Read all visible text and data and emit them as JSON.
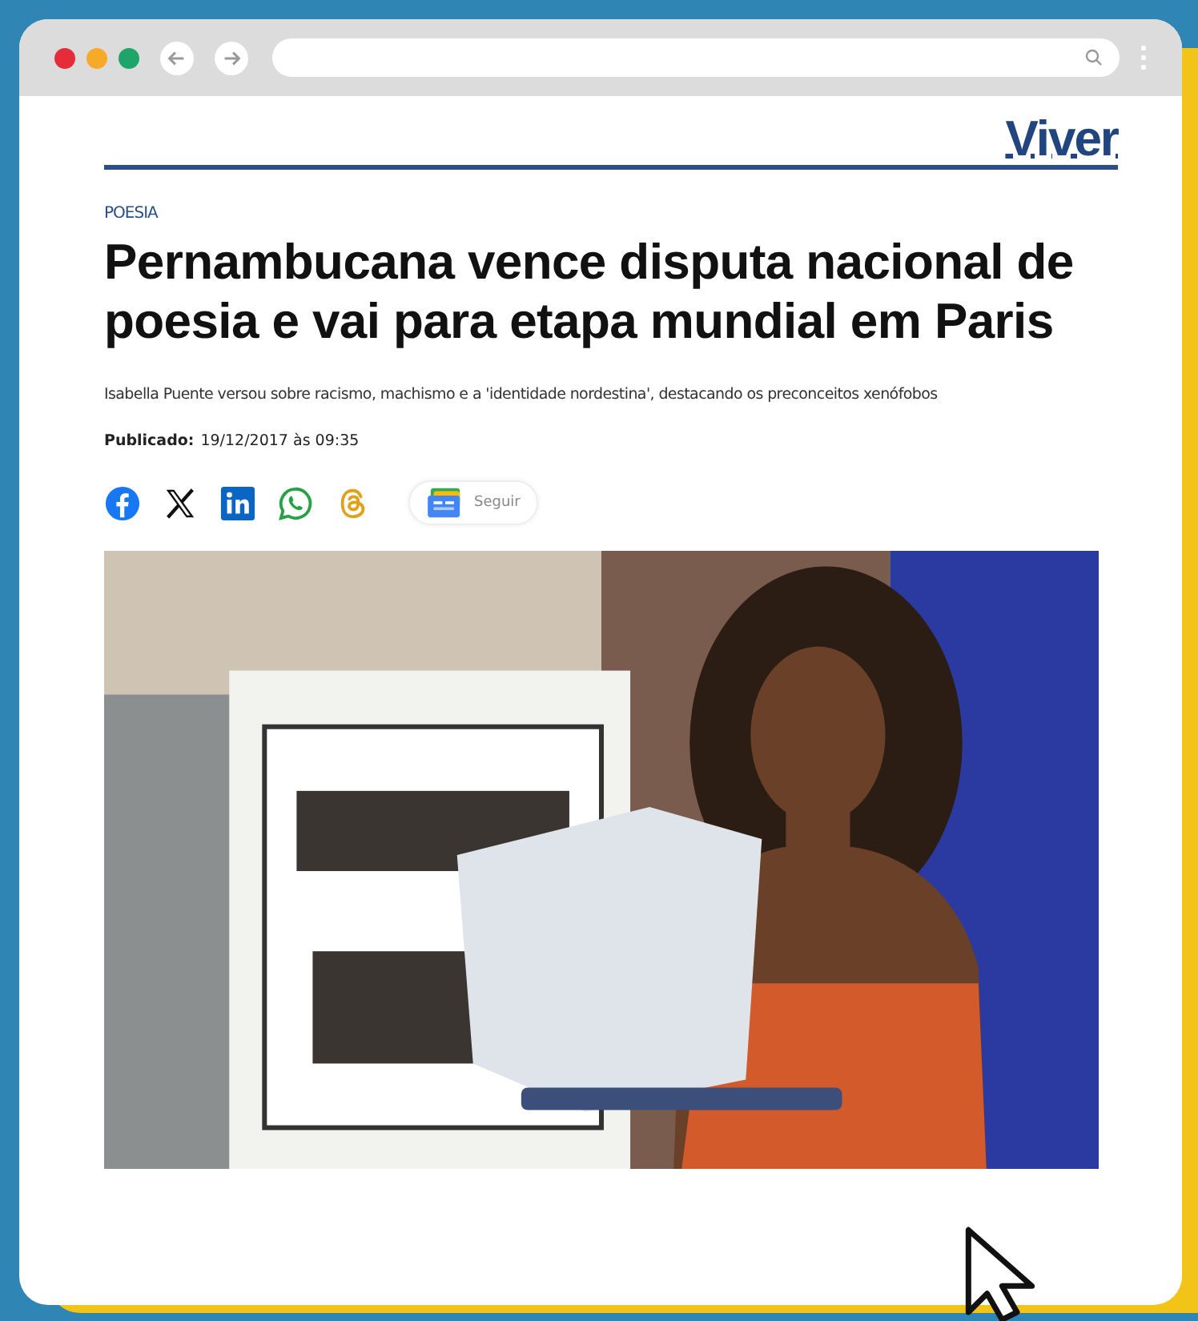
{
  "site": {
    "brand": "Viver"
  },
  "article": {
    "category": "POESIA",
    "headline": "Pernambucana vence disputa nacional de poesia e vai para etapa mundial em Paris",
    "subtitle": "Isabella Puente versou sobre racismo, machismo e a 'identidade nordestina', destacando os preconceitos xenófobos",
    "published_label": "Publicado:",
    "published_value": "19/12/2017 às 09:35",
    "follow_button": "Seguir"
  }
}
